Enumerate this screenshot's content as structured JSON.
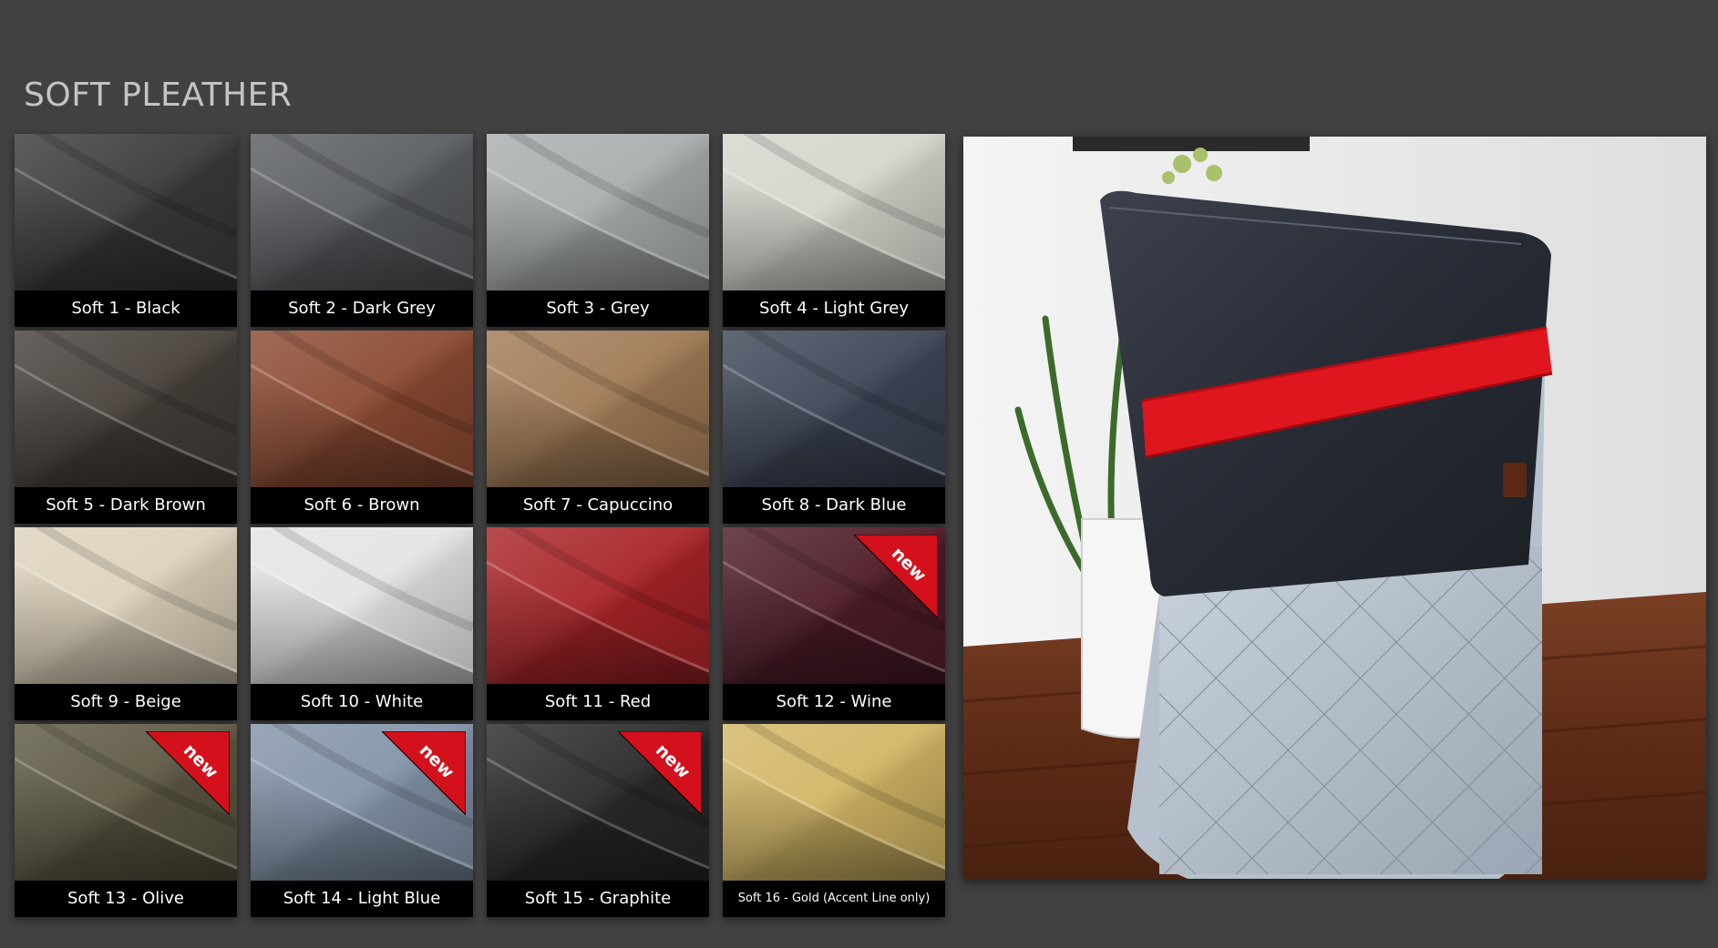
{
  "page": {
    "title": "SOFT PLEATHER"
  },
  "swatches": [
    {
      "label": "Soft 1 - Black",
      "color": "#3a3a3a",
      "is_new": false
    },
    {
      "label": "Soft 2 - Dark Grey",
      "color": "#5a5d61",
      "is_new": false
    },
    {
      "label": "Soft 3 - Grey",
      "color": "#a9adae",
      "is_new": false
    },
    {
      "label": "Soft 4 - Light Grey",
      "color": "#d4d5cc",
      "is_new": false
    },
    {
      "label": "Soft 5 - Dark Brown",
      "color": "#47403b",
      "is_new": false
    },
    {
      "label": "Soft 6 - Brown",
      "color": "#8b4a32",
      "is_new": false
    },
    {
      "label": "Soft 7 - Capuccino",
      "color": "#a07a55",
      "is_new": false
    },
    {
      "label": "Soft 8 - Dark Blue",
      "color": "#3e4657",
      "is_new": false
    },
    {
      "label": "Soft 9 - Beige",
      "color": "#ddd2bb",
      "is_new": false
    },
    {
      "label": "Soft 10 - White",
      "color": "#e4e4e2",
      "is_new": false
    },
    {
      "label": "Soft 11 - Red",
      "color": "#a82428",
      "is_new": false
    },
    {
      "label": "Soft 12 - Wine",
      "color": "#4e1c28",
      "is_new": true
    },
    {
      "label": "Soft 13 - Olive",
      "color": "#5d5843",
      "is_new": true
    },
    {
      "label": "Soft 14 - Light Blue",
      "color": "#8393a8",
      "is_new": true
    },
    {
      "label": "Soft 15 - Graphite",
      "color": "#2a2a2b",
      "is_new": true
    },
    {
      "label": "Soft 16 - Gold (Accent Line only)",
      "color": "#d2b665",
      "is_new": false
    }
  ],
  "badge": {
    "text": "new",
    "color": "#d4101c"
  },
  "photo": {
    "icon": "product-photo"
  }
}
